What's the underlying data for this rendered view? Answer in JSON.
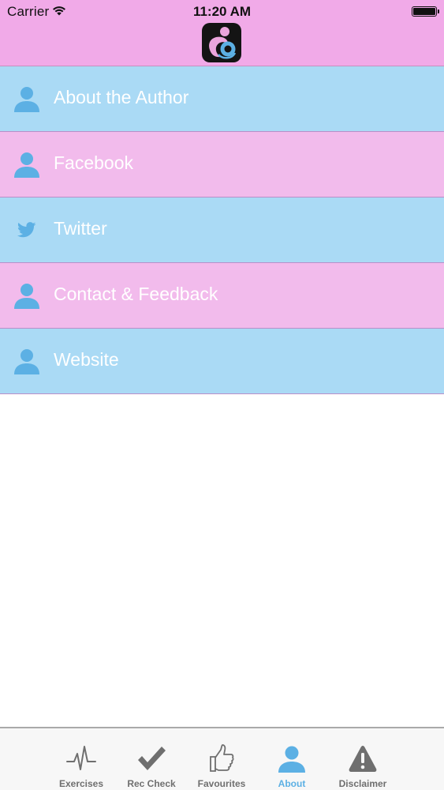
{
  "status_bar": {
    "carrier": "Carrier",
    "time": "11:20 AM"
  },
  "colors": {
    "header": "#f1aae8",
    "row_blue": "#aadaf5",
    "row_pink": "#f2bbec",
    "icon_blue": "#5cb0e4",
    "tab_active": "#5cb0e4",
    "tab_inactive": "#6f6f6f"
  },
  "menu": {
    "items": [
      {
        "label": "About the Author",
        "icon": "person-icon"
      },
      {
        "label": "Facebook",
        "icon": "person-icon"
      },
      {
        "label": "Twitter",
        "icon": "twitter-bird-icon"
      },
      {
        "label": "Contact & Feedback",
        "icon": "person-icon"
      },
      {
        "label": "Website",
        "icon": "person-icon"
      }
    ]
  },
  "tab_bar": {
    "tabs": [
      {
        "label": "Exercises",
        "icon": "heartbeat-icon"
      },
      {
        "label": "Rec Check",
        "icon": "checkmark-icon"
      },
      {
        "label": "Favourites",
        "icon": "thumbs-up-icon"
      },
      {
        "label": "About",
        "icon": "person-icon",
        "active": true
      },
      {
        "label": "Disclaimer",
        "icon": "warning-icon"
      }
    ]
  }
}
